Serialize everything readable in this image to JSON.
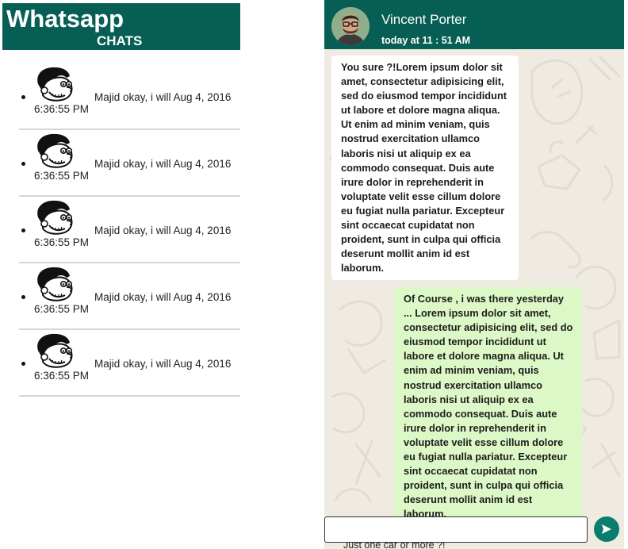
{
  "sidebar": {
    "app_title": "Whatsapp",
    "section_label": "CHATS",
    "chats": [
      {
        "preview": "Majid okay, i will Aug 4, 2016",
        "time": "6:36:55 PM",
        "avatar_icon": "cartoon-face-icon"
      },
      {
        "preview": "Majid okay, i will Aug 4, 2016",
        "time": "6:36:55 PM",
        "avatar_icon": "cartoon-face-icon"
      },
      {
        "preview": "Majid okay, i will Aug 4, 2016",
        "time": "6:36:55 PM",
        "avatar_icon": "cartoon-face-icon"
      },
      {
        "preview": "Majid okay, i will Aug 4, 2016",
        "time": "6:36:55 PM",
        "avatar_icon": "cartoon-face-icon"
      },
      {
        "preview": "Majid okay, i will Aug 4, 2016",
        "time": "6:36:55 PM",
        "avatar_icon": "cartoon-face-icon"
      }
    ]
  },
  "conversation": {
    "contact_name": "Vincent Porter",
    "contact_status": "today at 11 : 51 AM",
    "messages": [
      {
        "direction": "incoming",
        "text": "You sure ?!Lorem ipsum dolor sit amet, consectetur adipisicing elit, sed do eiusmod tempor incididunt ut labore et dolore magna aliqua. Ut enim ad minim veniam, quis nostrud exercitation ullamco laboris nisi ut aliquip ex ea commodo consequat. Duis aute irure dolor in reprehenderit in voluptate velit esse cillum dolore eu fugiat nulla pariatur. Excepteur sint occaecat cupidatat non proident, sunt in culpa qui officia deserunt mollit anim id est laborum."
      },
      {
        "direction": "outgoing",
        "text": "Of Course , i was there yesterday ... Lorem ipsum dolor sit amet, consectetur adipisicing elit, sed do eiusmod tempor incididunt ut labore et dolore magna aliqua. Ut enim ad minim veniam, quis nostrud exercitation ullamco laboris nisi ut aliquip ex ea commodo consequat. Duis aute irure dolor in reprehenderit in voluptate velit esse cillum dolore eu fugiat nulla pariatur. Excepteur sint occaecat cupidatat non proident, sunt in culpa qui officia deserunt mollit anim id est laborum."
      }
    ],
    "overflow_text": "Just one car or more ?!",
    "composer_value": "",
    "send_icon": "send-icon"
  },
  "colors": {
    "header": "#075e54",
    "incoming_bubble": "#ffffff",
    "outgoing_bubble": "#dcf8c6",
    "chat_background": "#efeae2",
    "send_button": "#0b7d6d"
  }
}
